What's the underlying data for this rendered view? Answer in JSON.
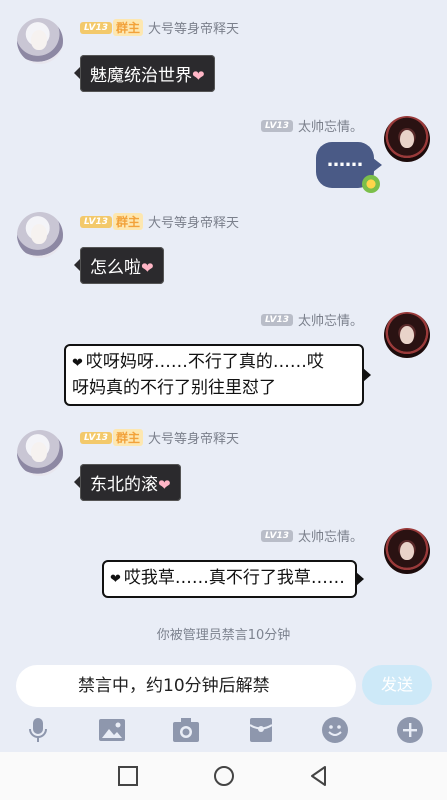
{
  "messages": [
    {
      "side": "left",
      "level": "LV13",
      "role": "群主",
      "name": "大号等身帝释天",
      "text": "魅魔统治世界",
      "heart": "❤"
    },
    {
      "side": "right",
      "level": "LV13",
      "name": "太帅忘情。",
      "sticker": "……"
    },
    {
      "side": "left",
      "level": "LV13",
      "role": "群主",
      "name": "大号等身帝释天",
      "text": "怎么啦",
      "heart": "❤"
    },
    {
      "side": "right",
      "level": "LV13",
      "name": "太帅忘情。",
      "text_line1": "哎呀妈呀……不行了真的……哎",
      "text_line2": "呀妈真的不行了别往里怼了",
      "heart": "❤"
    },
    {
      "side": "left",
      "level": "LV13",
      "role": "群主",
      "name": "大号等身帝释天",
      "text": "东北的滚",
      "heart": "❤"
    },
    {
      "side": "right",
      "level": "LV13",
      "name": "太帅忘情。",
      "text": "哎我草……真不行了我草……",
      "heart": "❤"
    }
  ],
  "system_note": "你被管理员禁言10分钟",
  "input": {
    "value": "禁言中，约10分钟后解禁",
    "send_label": "发送"
  },
  "toolbar": [
    "mic-icon",
    "image-icon",
    "camera-icon",
    "red-packet-icon",
    "emoji-icon",
    "plus-icon"
  ],
  "colors": {
    "background": "#e9edf6",
    "send_button": "#cde9f8",
    "dark_bubble": "#2b2a2d"
  }
}
